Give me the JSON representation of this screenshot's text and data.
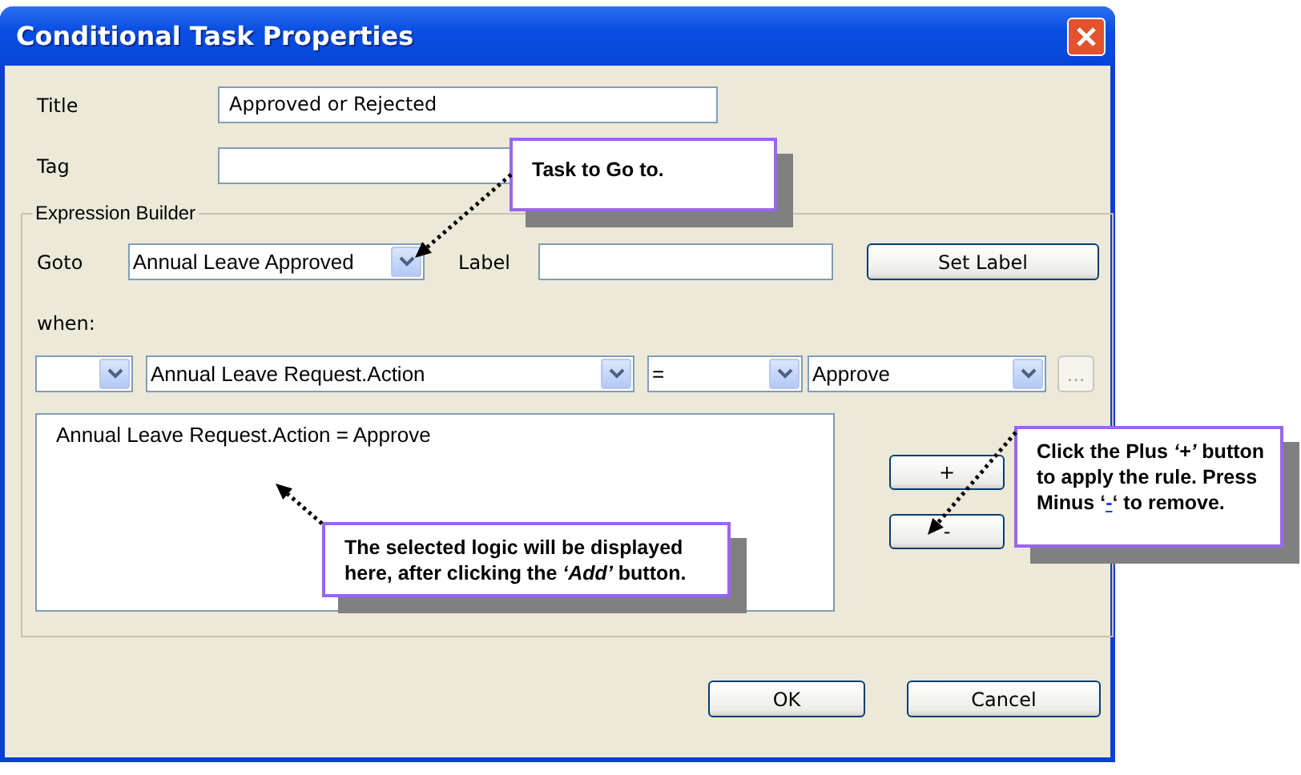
{
  "window": {
    "title": "Conditional Task Properties"
  },
  "fields": [
    {
      "label": "Title",
      "value": "Approved or Rejected"
    },
    {
      "label": "Tag"
    }
  ],
  "expression_builder": {
    "legend": "Expression Builder",
    "goto": {
      "label": "Goto",
      "value": "Annual Leave Approved"
    },
    "label_field": {
      "label": "Label"
    },
    "set_label_button": "Set Label",
    "when_label": "when:",
    "condition": [
      {
        "kind": "dropdown"
      },
      {
        "kind": "dropdown",
        "value": "Annual Leave Request.Action"
      },
      {
        "kind": "dropdown",
        "value": "="
      },
      {
        "kind": "dropdown",
        "value": "Approve"
      },
      {
        "kind": "button",
        "text": "...",
        "disabled": true
      }
    ],
    "expressions": [
      "Annual Leave Request.Action = Approve"
    ],
    "add_button": "+",
    "remove_button": "-"
  },
  "buttons": [
    "OK",
    "Cancel"
  ],
  "callouts": [
    {
      "text": "Task to Go to."
    },
    {
      "text": "The selected logic will be displayed here, after clicking the *‘Add’* button."
    },
    {
      "text": "Click the Plus *‘+’* button to apply the rule. Press Minus ‘",
      "link": "-",
      "text_after": "‘ to remove."
    }
  ]
}
